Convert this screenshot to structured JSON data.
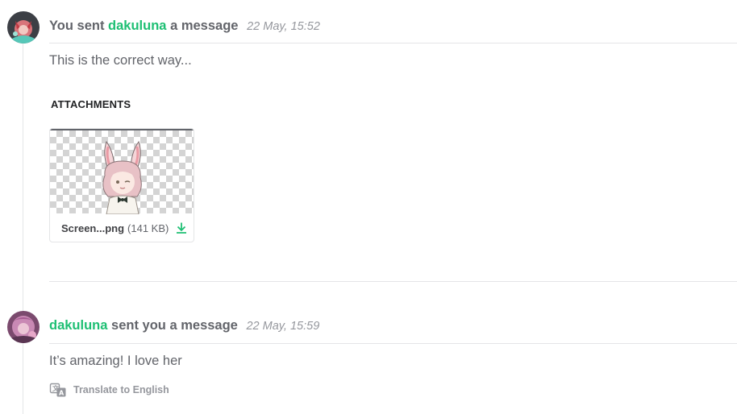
{
  "messages": [
    {
      "prefix": "You sent",
      "name": "dakuluna",
      "suffix": "a message",
      "timestamp": "22 May, 15:52",
      "body": "This is the correct way...",
      "attachments_title": "ATTACHMENTS",
      "attachment": {
        "file_name": "Screen...png",
        "file_size": "(141 KB)",
        "download_icon": "download-icon"
      }
    },
    {
      "name": "dakuluna",
      "suffix": "sent you a message",
      "timestamp": "22 May, 15:59",
      "body": "It’s amazing! I love her",
      "translate_label": "Translate to English",
      "translate_icon": "translate-icon"
    }
  ],
  "colors": {
    "accent": "#1dbf73",
    "text": "#62646a",
    "muted": "#95979d",
    "divider": "#e4e5e7"
  }
}
